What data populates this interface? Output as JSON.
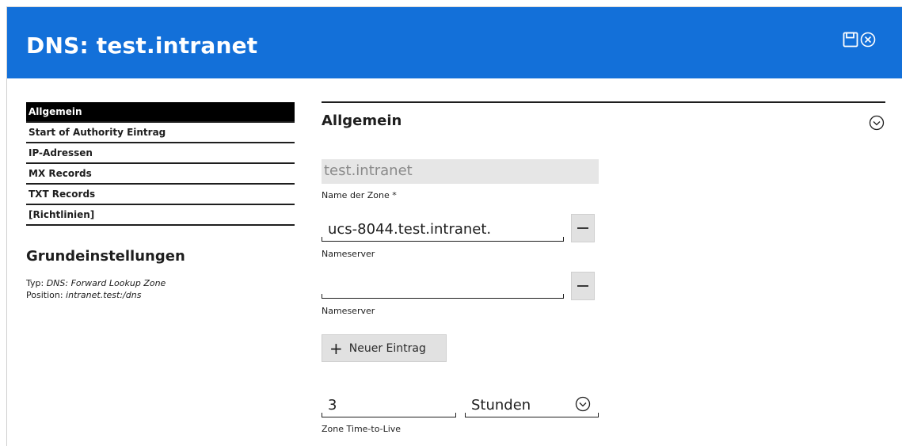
{
  "header": {
    "title": "DNS: test.intranet"
  },
  "nav": {
    "items": [
      {
        "label": "Allgemein",
        "active": true
      },
      {
        "label": "Start of Authority Eintrag",
        "active": false
      },
      {
        "label": "IP-Adressen",
        "active": false
      },
      {
        "label": "MX Records",
        "active": false
      },
      {
        "label": "TXT Records",
        "active": false
      },
      {
        "label": "[Richtlinien]",
        "active": false
      }
    ]
  },
  "basic_settings": {
    "title": "Grundeinstellungen",
    "type_label": "Typ: ",
    "type_value": "DNS: Forward Lookup Zone",
    "position_label": "Position: ",
    "position_value": "intranet.test:/dns"
  },
  "section": {
    "title": "Allgemein"
  },
  "zone_name": {
    "value": "test.intranet",
    "label": "Name der Zone *"
  },
  "nameservers": [
    {
      "value": "ucs-8044.test.intranet.",
      "label": "Nameserver"
    },
    {
      "value": "",
      "label": "Nameserver"
    }
  ],
  "add_entry": {
    "label": "Neuer Eintrag"
  },
  "ttl": {
    "value": "3",
    "unit": "Stunden",
    "label": "Zone Time-to-Live"
  },
  "colors": {
    "header_bg": "#1370d9",
    "active_nav_bg": "#000000"
  },
  "icons": {
    "save": "save-icon",
    "close": "close-icon",
    "collapse": "chevron-down-circle-icon",
    "remove": "minus-icon",
    "add": "plus-icon"
  }
}
